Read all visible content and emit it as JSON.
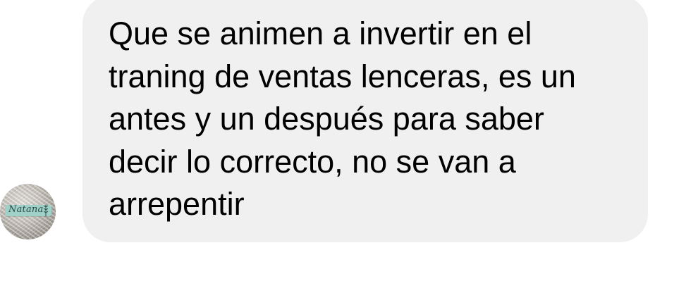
{
  "conversation": {
    "message": {
      "lines": [
        "Que se animen a invertir en el",
        "traning de ventas lenceras, es un",
        "antes y un después para saber",
        "decir lo correcto, no se van a",
        "arrepentir"
      ],
      "bubble_color": "#f0f0f0",
      "text_color": "#000000"
    },
    "sender": {
      "avatar_label": "Natana",
      "avatar_banner_color": "#9fd1c8"
    }
  }
}
